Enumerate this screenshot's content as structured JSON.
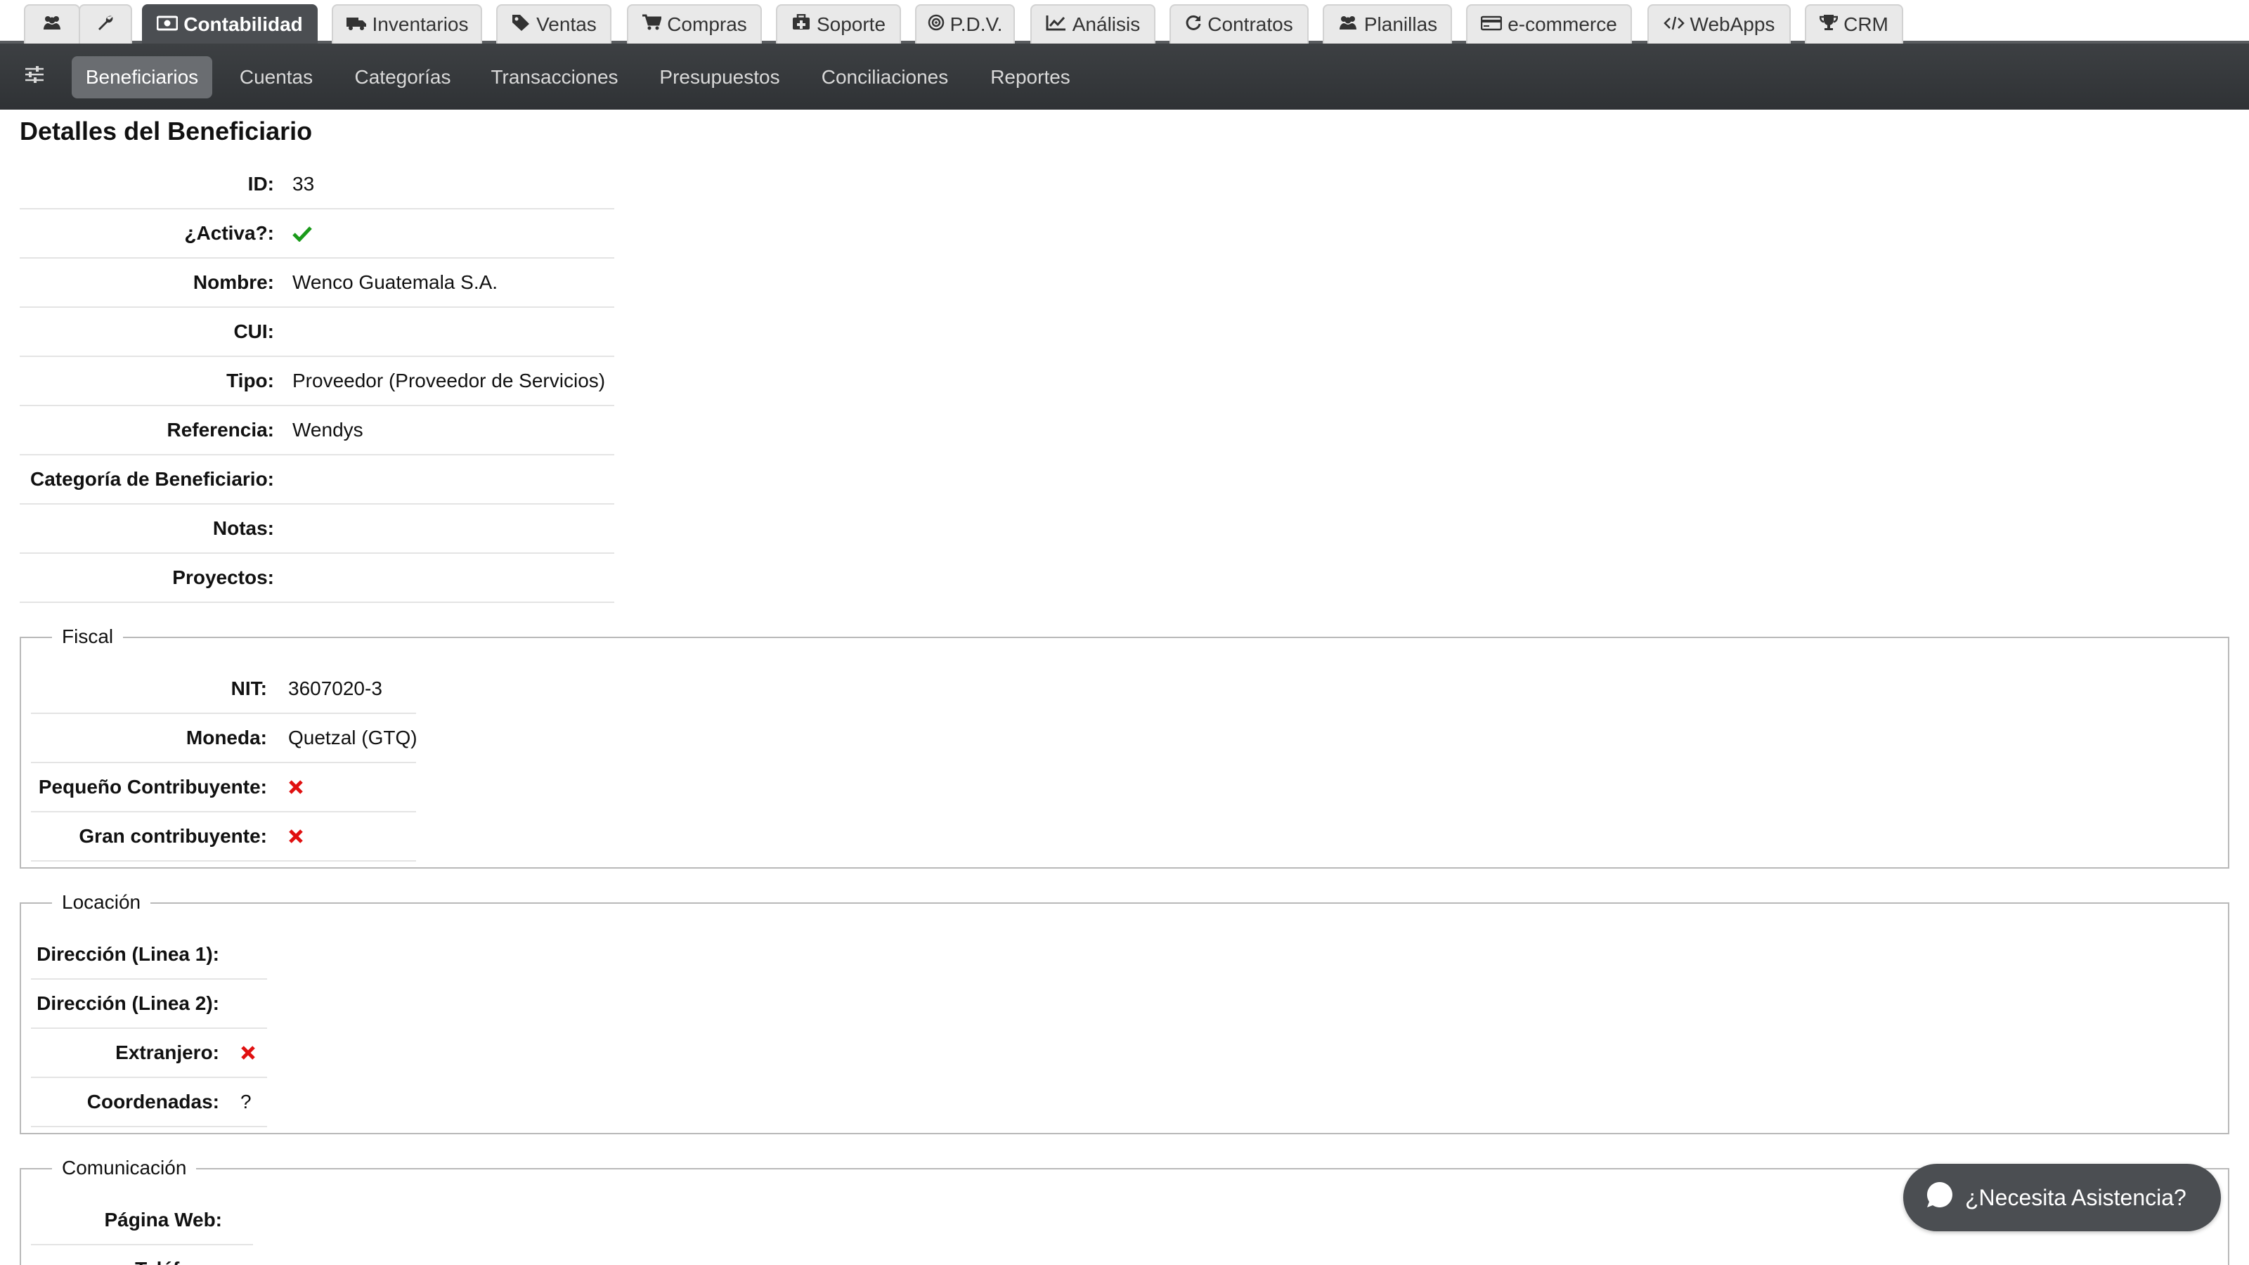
{
  "tabs": [
    {
      "label": "",
      "icon": "users-icon"
    },
    {
      "label": "",
      "icon": "wrench-icon"
    },
    {
      "label": "Contabilidad",
      "icon": "money-icon",
      "active": true
    },
    {
      "label": "Inventarios",
      "icon": "truck-icon"
    },
    {
      "label": "Ventas",
      "icon": "tags-icon"
    },
    {
      "label": "Compras",
      "icon": "cart-icon"
    },
    {
      "label": "Soporte",
      "icon": "medkit-icon"
    },
    {
      "label": "P.D.V.",
      "icon": "target-icon"
    },
    {
      "label": "Análisis",
      "icon": "line-chart-icon"
    },
    {
      "label": "Contratos",
      "icon": "refresh-icon"
    },
    {
      "label": "Planillas",
      "icon": "users-icon"
    },
    {
      "label": "e-commerce",
      "icon": "credit-card-icon"
    },
    {
      "label": "WebApps",
      "icon": "code-icon"
    },
    {
      "label": "CRM",
      "icon": "trophy-icon"
    }
  ],
  "subnav": {
    "items": [
      "Beneficiarios",
      "Cuentas",
      "Categorías",
      "Transacciones",
      "Presupuestos",
      "Conciliaciones",
      "Reportes"
    ],
    "active_index": 0
  },
  "page": {
    "title": "Detalles del Beneficiario"
  },
  "details": [
    {
      "label": "ID:",
      "value": "33"
    },
    {
      "label": "¿Activa?:",
      "value": "",
      "icon": "check-icon"
    },
    {
      "label": "Nombre:",
      "value": "Wenco Guatemala S.A."
    },
    {
      "label": "CUI:",
      "value": ""
    },
    {
      "label": "Tipo:",
      "value": "Proveedor (Proveedor de Servicios)"
    },
    {
      "label": "Referencia:",
      "value": "Wendys"
    },
    {
      "label": "Categoría de Beneficiario:",
      "value": ""
    },
    {
      "label": "Notas:",
      "value": ""
    },
    {
      "label": "Proyectos:",
      "value": ""
    }
  ],
  "fiscal": {
    "legend": "Fiscal",
    "rows": [
      {
        "label": "NIT:",
        "value": "3607020-3"
      },
      {
        "label": "Moneda:",
        "value": "Quetzal (GTQ)"
      },
      {
        "label": "Pequeño Contribuyente:",
        "value": "",
        "icon": "x-icon"
      },
      {
        "label": "Gran contribuyente:",
        "value": "",
        "icon": "x-icon"
      }
    ]
  },
  "locacion": {
    "legend": "Locación",
    "rows": [
      {
        "label": "Dirección (Linea 1):",
        "value": ""
      },
      {
        "label": "Dirección (Linea 2):",
        "value": ""
      },
      {
        "label": "Extranjero:",
        "value": "",
        "icon": "x-icon"
      },
      {
        "label": "Coordenadas:",
        "value": "?"
      }
    ]
  },
  "comunicacion": {
    "legend": "Comunicación",
    "rows": [
      {
        "label": "Página Web:",
        "value": ""
      },
      {
        "label": "Teléfono:",
        "value": ""
      }
    ]
  },
  "chat": {
    "label": "¿Necesita Asistencia?"
  },
  "colors": {
    "accent": "#4b4e52",
    "ok": "#1a9a1a",
    "bad": "#e01010"
  }
}
